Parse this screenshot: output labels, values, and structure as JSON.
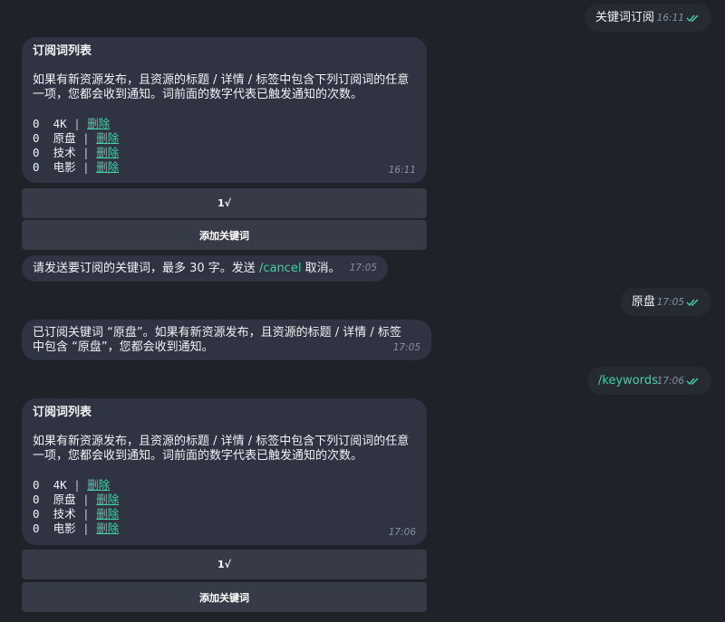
{
  "messages": {
    "m1": {
      "text": "关键词订阅",
      "time": "16:11"
    },
    "list1": {
      "title": "订阅词列表",
      "desc": "如果有新资源发布，且资源的标题 / 详情 / 标签中包含下列订阅词的任意一项，您都会收到通知。词前面的数字代表已触发通知的次数。",
      "time": "16:11"
    },
    "buttons1": {
      "page": "1√",
      "add": "添加关键词"
    },
    "prompt": {
      "pre": "请发送要订阅的关键词，最多 30 字。发送 ",
      "cmd": "/cancel",
      "post": " 取消。",
      "time": "17:05"
    },
    "m2": {
      "text": "原盘",
      "time": "17:05"
    },
    "confirm": {
      "line1": "已订阅关键词 “原盘”。如果有新资源发布，且资源的标题 / 详情 / 标签",
      "line2": "中包含 “原盘”，您都会收到通知。",
      "time": "17:05"
    },
    "m3": {
      "text": "/keywords",
      "time": "17:06"
    },
    "list2": {
      "title": "订阅词列表",
      "desc": "如果有新资源发布，且资源的标题 / 详情 / 标签中包含下列订阅词的任意一项，您都会收到通知。词前面的数字代表已触发通知的次数。",
      "time": "17:06"
    },
    "buttons2": {
      "page": "1√",
      "add": "添加关键词"
    }
  },
  "keywords": [
    {
      "count": "0",
      "word": "4K",
      "action": "删除"
    },
    {
      "count": "0",
      "word": "原盘",
      "action": "删除"
    },
    {
      "count": "0",
      "word": "技术",
      "action": "删除"
    },
    {
      "count": "0",
      "word": "电影",
      "action": "删除"
    }
  ],
  "colors": {
    "background": "#1f2229",
    "incoming": "#2f3342",
    "outgoing": "#262a33",
    "accent": "#3fd3a8",
    "button": "#373b47"
  }
}
